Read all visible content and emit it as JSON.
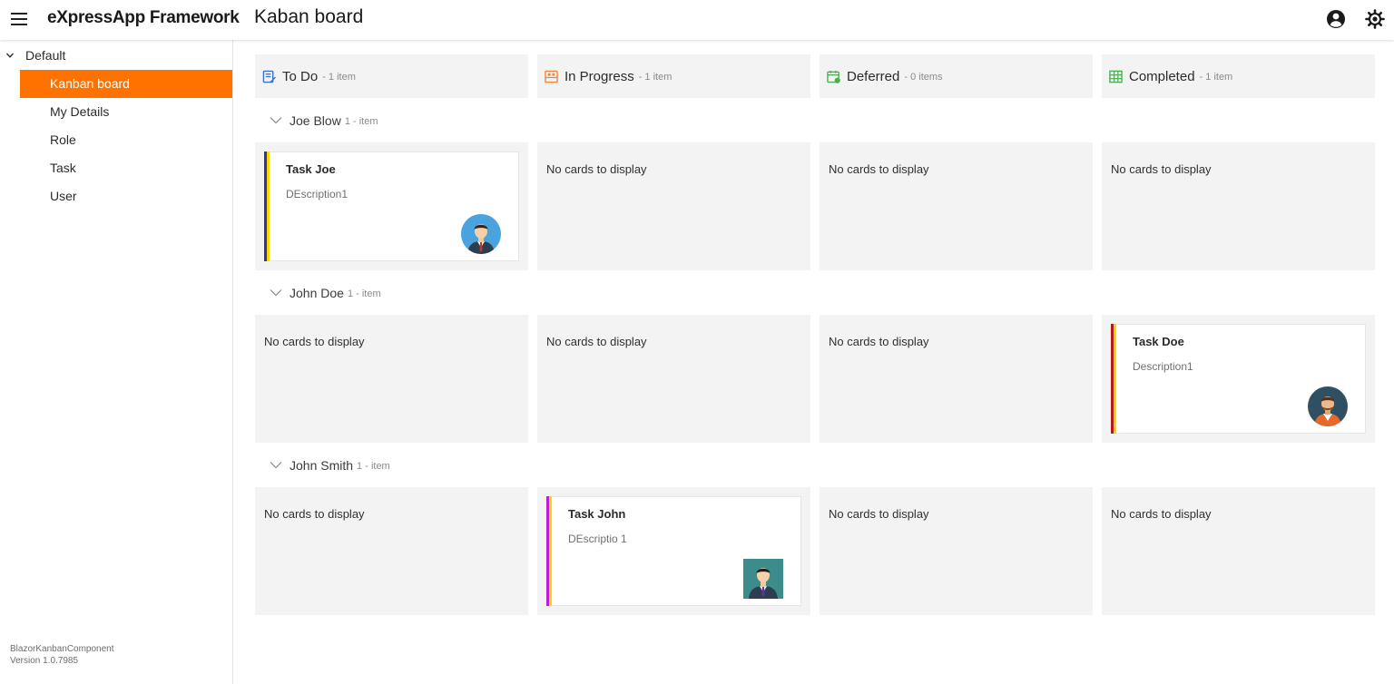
{
  "header": {
    "brand": "eXpressApp Framework",
    "title": "Kaban board"
  },
  "sidebar": {
    "group_label": "Default",
    "items": [
      {
        "label": "Kanban board",
        "active": true
      },
      {
        "label": "My Details"
      },
      {
        "label": "Role"
      },
      {
        "label": "Task"
      },
      {
        "label": "User"
      }
    ],
    "footer_name": "BlazorKanbanComponent",
    "footer_version": "Version 1.0.7985"
  },
  "columns": [
    {
      "title": "To Do",
      "count": "- 1 item",
      "icon": "todo-icon",
      "color": "#3a6fd8"
    },
    {
      "title": "In Progress",
      "count": "- 1 item",
      "icon": "in-progress-icon",
      "color": "#f0883b"
    },
    {
      "title": "Deferred",
      "count": "- 0 items",
      "icon": "deferred-icon",
      "color": "#4caf50"
    },
    {
      "title": "Completed",
      "count": "- 1 item",
      "icon": "completed-icon",
      "color": "#4caf50"
    }
  ],
  "lanes": [
    {
      "name": "Joe Blow",
      "count": "1 - item",
      "cells": [
        {
          "card": {
            "title": "Task Joe",
            "desc": "DEscription1",
            "stripe_a": "#2b3896",
            "stripe_b": "#ffd600",
            "avatar": "round-blue"
          }
        },
        {
          "empty": "No cards to display"
        },
        {
          "empty": "No cards to display"
        },
        {
          "empty": "No cards to display"
        }
      ]
    },
    {
      "name": "John Doe",
      "count": "1 - item",
      "cells": [
        {
          "empty": "No cards to display"
        },
        {
          "empty": "No cards to display"
        },
        {
          "empty": "No cards to display"
        },
        {
          "card": {
            "title": "Task Doe",
            "desc": "Description1",
            "stripe_a": "#b31b1b",
            "stripe_b": "#ffd600",
            "avatar": "round-dark"
          }
        }
      ]
    },
    {
      "name": "John Smith",
      "count": "1 - item",
      "cells": [
        {
          "empty": "No cards to display"
        },
        {
          "card": {
            "title": "Task John",
            "desc": "DEscriptio 1",
            "stripe_a": "#c21bd6",
            "stripe_b": "#ffd600",
            "avatar": "square-teal"
          }
        },
        {
          "empty": "No cards to display"
        },
        {
          "empty": "No cards to display"
        }
      ]
    }
  ],
  "colors": {
    "accent": "#ff7200",
    "panel": "#f3f3f3"
  }
}
